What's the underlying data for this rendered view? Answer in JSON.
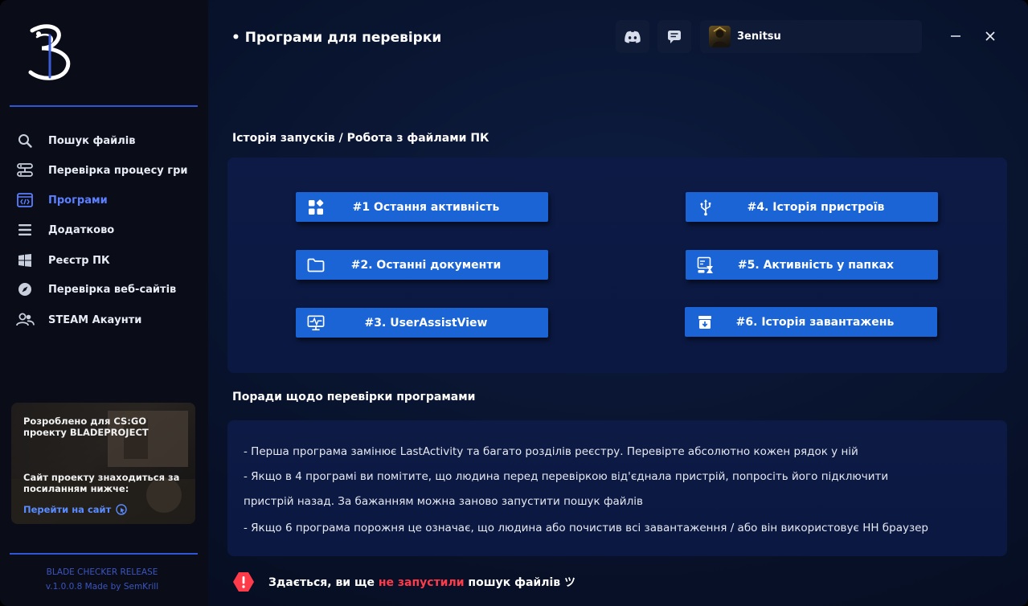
{
  "sidebar": {
    "items": [
      {
        "label": "Пошук файлів",
        "icon": "search-icon"
      },
      {
        "label": "Перевірка процесу гри",
        "icon": "process-icon"
      },
      {
        "label": "Програми",
        "icon": "code-window-icon",
        "active": true
      },
      {
        "label": "Додатково",
        "icon": "menu-icon"
      },
      {
        "label": "Реєстр ПК",
        "icon": "windows-icon"
      },
      {
        "label": "Перевірка веб-сайтів",
        "icon": "compass-icon"
      },
      {
        "label": "STEAM Акаунти",
        "icon": "users-icon"
      }
    ],
    "promo": {
      "line1": "Розроблено для CS:GO",
      "line2": "проекту BLADEPROJECT",
      "line3": "Сайт проекту знаходиться за",
      "line4": "посиланням нижче:",
      "link": "Перейти на сайт"
    },
    "footer": {
      "release": "BLADE CHECKER RELEASE",
      "version": "v.1.0.0.8 Made by SemKrill"
    }
  },
  "header": {
    "title": "• Програми для перевірки",
    "username": "3enitsu"
  },
  "section1": {
    "title": "Історія запусків / Робота з файлами ПК",
    "buttons": [
      {
        "label": "#1 Остання активність",
        "icon": "apps-icon"
      },
      {
        "label": "#2. Останні документи",
        "icon": "folder-icon"
      },
      {
        "label": "#3. UserAssistView",
        "icon": "monitor-pulse-icon"
      },
      {
        "label": "#4. Історія пристроїв",
        "icon": "usb-icon"
      },
      {
        "label": "#5. Активність у папках",
        "icon": "folder-activity-icon"
      },
      {
        "label": "#6. Історія завантажень",
        "icon": "download-box-icon"
      }
    ]
  },
  "section2": {
    "title": "Поради щодо перевірки програмами",
    "tips": [
      "- Перша програма замінює LastActivity та багато розділів реєстру. Перевірте абсолютно кожен рядок у ній",
      "- Якщо в 4 програмі ви помітите, що людина перед перевіркою від'єднала пристрій, попросіть його підключити",
      "пристрій назад. За бажанням можна заново запустити пошук файлів",
      "- Якщо 6 програма порожня це означає, що людина або почистив всі завантаження / або він використовує НН браузер"
    ]
  },
  "warning": {
    "before": "Здається, ви ще ",
    "highlight": "не запустили",
    "after": " пошук файлів ツ"
  },
  "colors": {
    "accent": "#1a64d6",
    "active_nav": "#5b7fff",
    "warning_red": "#ff3b4a"
  }
}
